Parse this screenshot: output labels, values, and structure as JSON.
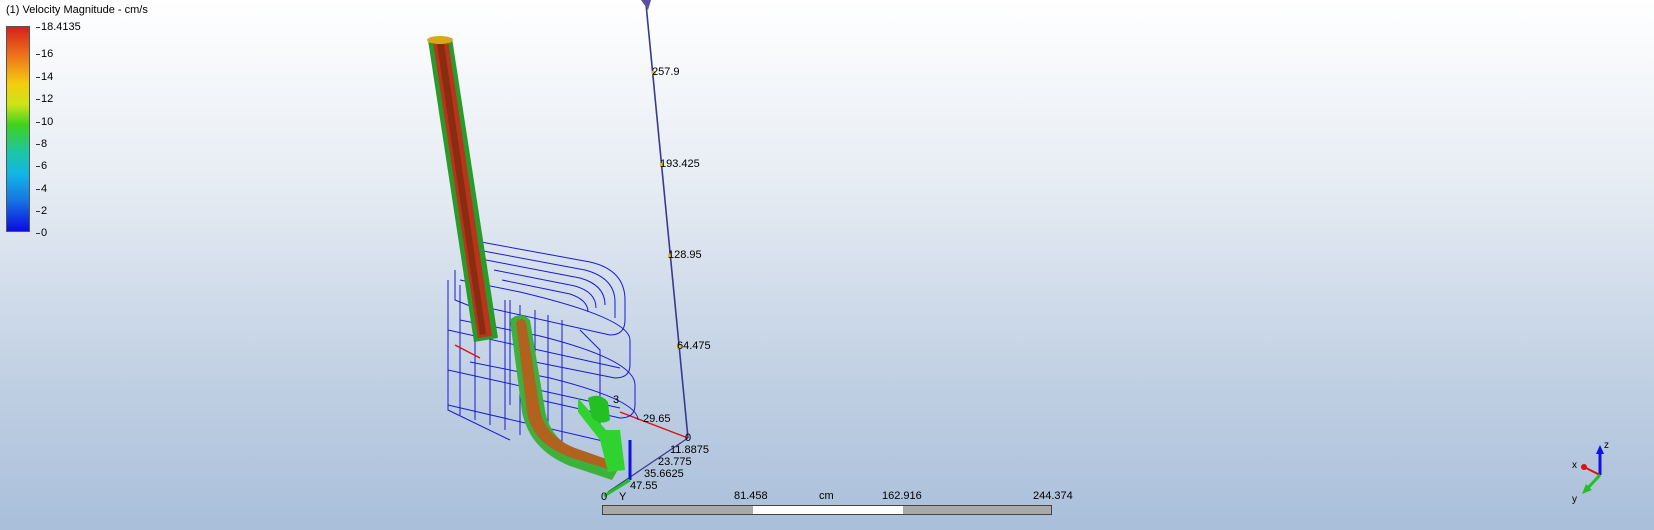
{
  "legend": {
    "title": "(1) Velocity Magnitude - cm/s",
    "max_label": "18.4135",
    "ticks": [
      "16",
      "14",
      "12",
      "10",
      "8",
      "6",
      "4",
      "2",
      "0"
    ]
  },
  "vertical_axis": {
    "labels": [
      "257.9",
      "193.425",
      "128.95",
      "64.475",
      "0"
    ]
  },
  "side_axis": {
    "labels": [
      "29.65",
      "11.8875",
      "23.775",
      "35.6625",
      "47.55",
      "3"
    ]
  },
  "scale": {
    "labels": [
      "0",
      "81.458",
      "cm",
      "162.916",
      "244.374"
    ],
    "origin_axis_label": "Y"
  },
  "triad": {
    "x": "x",
    "y": "y",
    "z": "z"
  },
  "colors": {
    "axis": "#3a3a8c",
    "wire": "#1a1ad8",
    "red_axis": "#e01010",
    "green_axis": "#22c022",
    "blue_axis": "#1010e0"
  }
}
